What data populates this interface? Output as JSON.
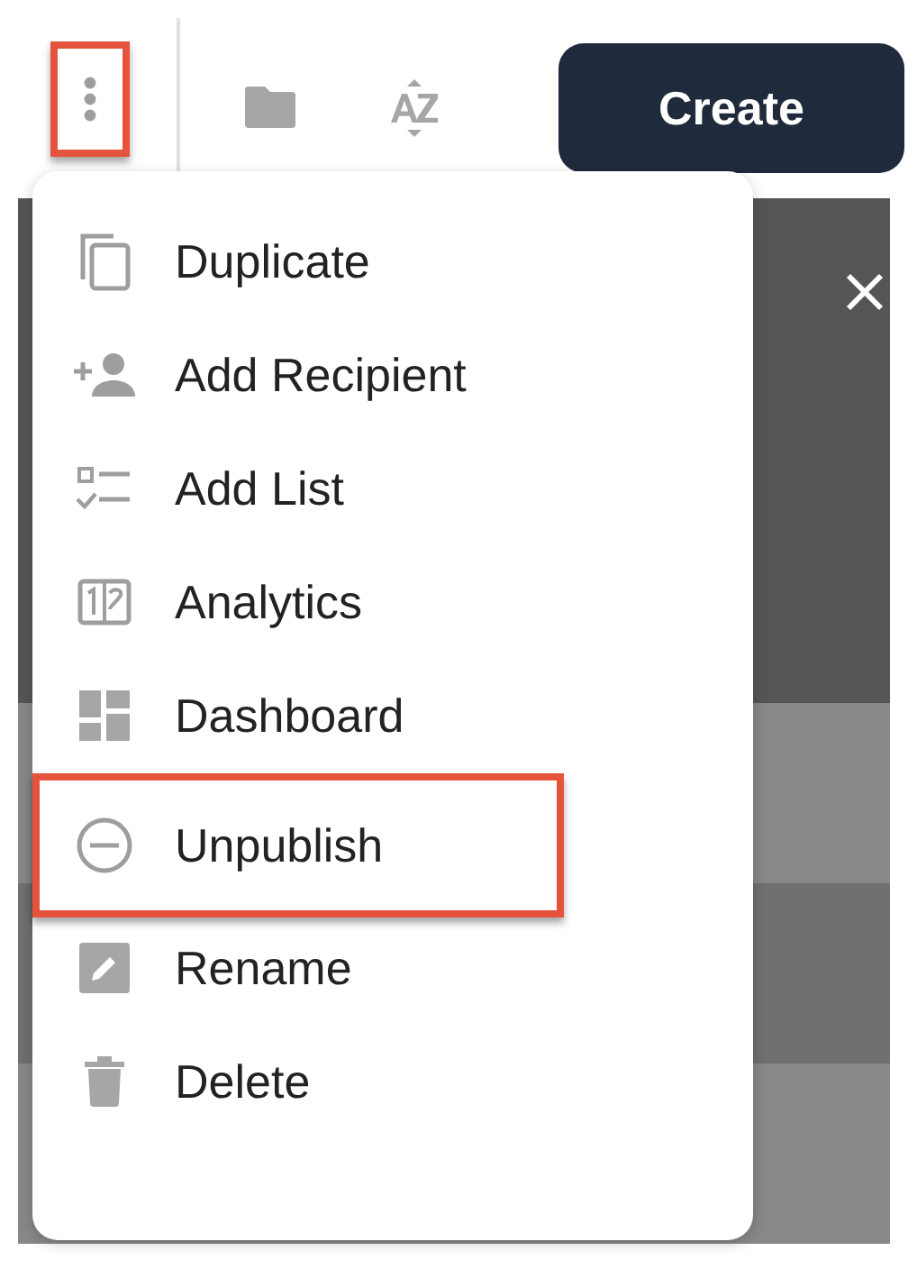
{
  "toolbar": {
    "more_button": {
      "highlighted": true
    },
    "create_button": {
      "label": "Create"
    }
  },
  "menu": {
    "items": [
      {
        "kind": "duplicate",
        "label": "Duplicate",
        "highlighted": false
      },
      {
        "kind": "add-recipient",
        "label": "Add Recipient",
        "highlighted": false
      },
      {
        "kind": "add-list",
        "label": "Add List",
        "highlighted": false
      },
      {
        "kind": "analytics",
        "label": "Analytics",
        "highlighted": false
      },
      {
        "kind": "dashboard",
        "label": "Dashboard",
        "highlighted": false
      },
      {
        "kind": "unpublish",
        "label": "Unpublish",
        "highlighted": true
      },
      {
        "kind": "rename",
        "label": "Rename",
        "highlighted": false
      },
      {
        "kind": "delete",
        "label": "Delete",
        "highlighted": false
      }
    ]
  }
}
